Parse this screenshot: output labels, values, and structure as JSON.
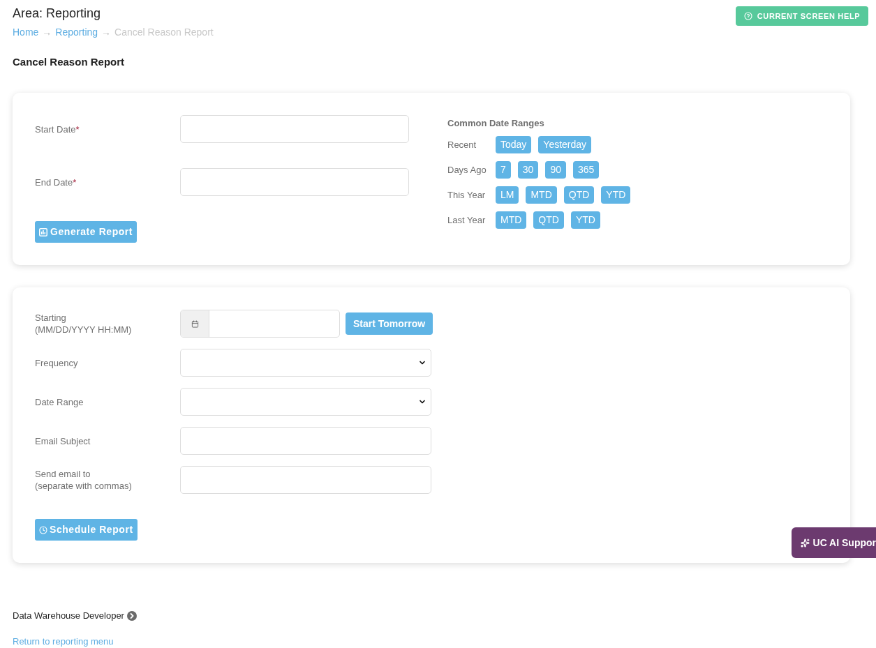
{
  "header": {
    "area_title": "Area: Reporting",
    "help_button": "CURRENT SCREEN HELP"
  },
  "breadcrumb": [
    {
      "label": "Home",
      "kind": "link",
      "separator": "→"
    },
    {
      "label": "Reporting",
      "kind": "link",
      "separator": "→"
    },
    {
      "label": "Cancel Reason Report",
      "kind": "current"
    }
  ],
  "page_title": "Cancel Reason Report",
  "report_card": {
    "fields": [
      {
        "label": "Start Date",
        "required_mark": "*"
      },
      {
        "label": "End Date",
        "required_mark": "*"
      }
    ],
    "generate_button": "Generate Report",
    "date_ranges": {
      "title": "Common Date Ranges",
      "groups": [
        {
          "label": "Recent",
          "buttons": [
            "Today",
            "Yesterday"
          ]
        },
        {
          "label": "Days Ago",
          "buttons": [
            "7",
            "30",
            "90",
            "365"
          ]
        },
        {
          "label": "This Year",
          "buttons": [
            "LM",
            "MTD",
            "QTD",
            "YTD"
          ]
        },
        {
          "label": "Last Year",
          "buttons": [
            "MTD",
            "QTD",
            "YTD"
          ]
        }
      ]
    }
  },
  "schedule_card": {
    "fields": [
      {
        "kind": "datetime",
        "label": "Starting",
        "hint": "(MM/DD/YYYY HH:MM)",
        "button": "Start Tomorrow"
      },
      {
        "kind": "select",
        "label": "Frequency"
      },
      {
        "kind": "select",
        "label": "Date Range"
      },
      {
        "kind": "text",
        "label": "Email Subject"
      },
      {
        "kind": "text",
        "label": "Send email to",
        "hint": "(separate with commas)"
      }
    ],
    "schedule_button": "Schedule Report"
  },
  "footer": {
    "developer": "Data Warehouse Developer",
    "return_link": "Return to reporting menu"
  },
  "ai_support_tab": "UC AI Suppor"
}
